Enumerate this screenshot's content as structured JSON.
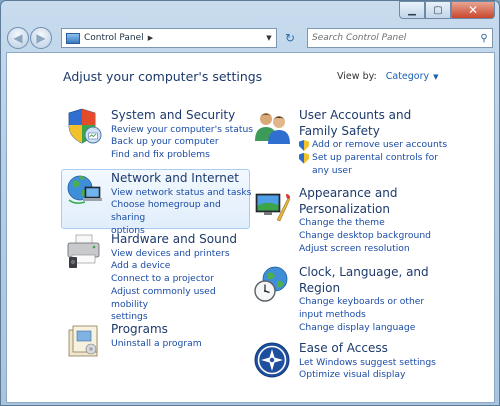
{
  "window": {
    "caption": {
      "minimize": "▁",
      "maximize": "▢",
      "close": "✕"
    }
  },
  "nav": {
    "back": "◀",
    "forward": "▶",
    "address": "Control Panel",
    "separator": "▶",
    "dropdown": "▼",
    "refresh": "↻",
    "search_placeholder": "Search Control Panel",
    "search_icon": "⚲"
  },
  "header": {
    "title": "Adjust your computer's settings",
    "view_by_label": "View by:",
    "view_by_value": "Category",
    "view_by_caret": "▼"
  },
  "categories_left": [
    {
      "title": "System and Security",
      "icon": "system-security-icon",
      "links": [
        "Review your computer's status",
        "Back up your computer",
        "Find and fix problems"
      ]
    },
    {
      "title": "Network and Internet",
      "icon": "network-internet-icon",
      "links": [
        "View network status and tasks",
        "Choose homegroup and sharing",
        "options"
      ]
    },
    {
      "title": "Hardware and Sound",
      "icon": "hardware-sound-icon",
      "links": [
        "View devices and printers",
        "Add a device",
        "Connect to a projector",
        "Adjust commonly used mobility",
        "settings"
      ]
    },
    {
      "title": "Programs",
      "icon": "programs-icon",
      "links": [
        "Uninstall a program"
      ]
    }
  ],
  "categories_right": [
    {
      "title_lines": [
        "User Accounts and",
        "Family Safety"
      ],
      "icon": "user-accounts-icon",
      "links": [
        "Add or remove user accounts",
        "Set up parental controls for",
        "any user"
      ]
    },
    {
      "title_lines": [
        "Appearance and",
        "Personalization"
      ],
      "icon": "appearance-icon",
      "links": [
        "Change the theme",
        "Change desktop background",
        "Adjust screen resolution"
      ]
    },
    {
      "title_lines": [
        "Clock, Language, and",
        "Region"
      ],
      "icon": "clock-language-icon",
      "links": [
        "Change keyboards or other",
        "input methods",
        "Change display language"
      ]
    },
    {
      "title_lines": [
        "Ease of Access"
      ],
      "icon": "ease-of-access-icon",
      "links": [
        "Let Windows suggest settings",
        "Optimize visual display"
      ]
    }
  ]
}
